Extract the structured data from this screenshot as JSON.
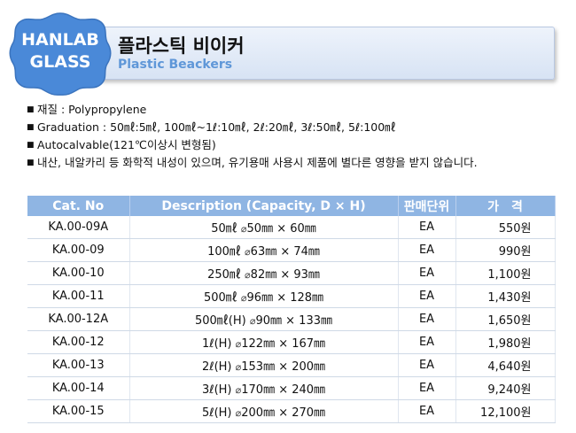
{
  "header": {
    "badge_line1": "HANLAB",
    "badge_line2": "GLASS",
    "title": "플라스틱 비이커",
    "subtitle": "Plastic Beackers"
  },
  "colors": {
    "badge": "#4a89d8",
    "table_header": "#8fb5e3",
    "subtitle": "#5f97d8"
  },
  "bullets": [
    "재질 : Polypropylene",
    "Graduation : 50㎖:5㎖, 100㎖~1ℓ:10㎖, 2ℓ:20㎖, 3ℓ:50㎖, 5ℓ:100㎖",
    "Autocalvable(121℃이상시 변형됨)",
    "내산, 내알카리 등 화학적 내성이 있으며, 유기용매 사용시 제품에 별다른 영향을 받지 않습니다."
  ],
  "table": {
    "headers": [
      "Cat. No",
      "Description (Capacity, D × H)",
      "판매단위",
      "가　격"
    ],
    "rows": [
      {
        "cat": "KA.00-09A",
        "cap": "50㎖",
        "dim": "50㎜ × 60㎜",
        "unit": "EA",
        "price": "550원"
      },
      {
        "cat": "KA.00-09",
        "cap": "100㎖",
        "dim": "63㎜ × 74㎜",
        "unit": "EA",
        "price": "990원"
      },
      {
        "cat": "KA.00-10",
        "cap": "250㎖",
        "dim": "82㎜ × 93㎜",
        "unit": "EA",
        "price": "1,100원"
      },
      {
        "cat": "KA.00-11",
        "cap": "500㎖",
        "dim": "96㎜ × 128㎜",
        "unit": "EA",
        "price": "1,430원"
      },
      {
        "cat": "KA.00-12A",
        "cap": "500㎖(H)",
        "dim": "90㎜ × 133㎜",
        "unit": "EA",
        "price": "1,650원"
      },
      {
        "cat": "KA.00-12",
        "cap": "1ℓ(H)",
        "dim": "122㎜ × 167㎜",
        "unit": "EA",
        "price": "1,980원"
      },
      {
        "cat": "KA.00-13",
        "cap": "2ℓ(H)",
        "dim": "153㎜ × 200㎜",
        "unit": "EA",
        "price": "4,640원"
      },
      {
        "cat": "KA.00-14",
        "cap": "3ℓ(H)",
        "dim": "170㎜ × 240㎜",
        "unit": "EA",
        "price": "9,240원"
      },
      {
        "cat": "KA.00-15",
        "cap": "5ℓ(H)",
        "dim": "200㎜ × 270㎜",
        "unit": "EA",
        "price": "12,100원"
      }
    ]
  }
}
